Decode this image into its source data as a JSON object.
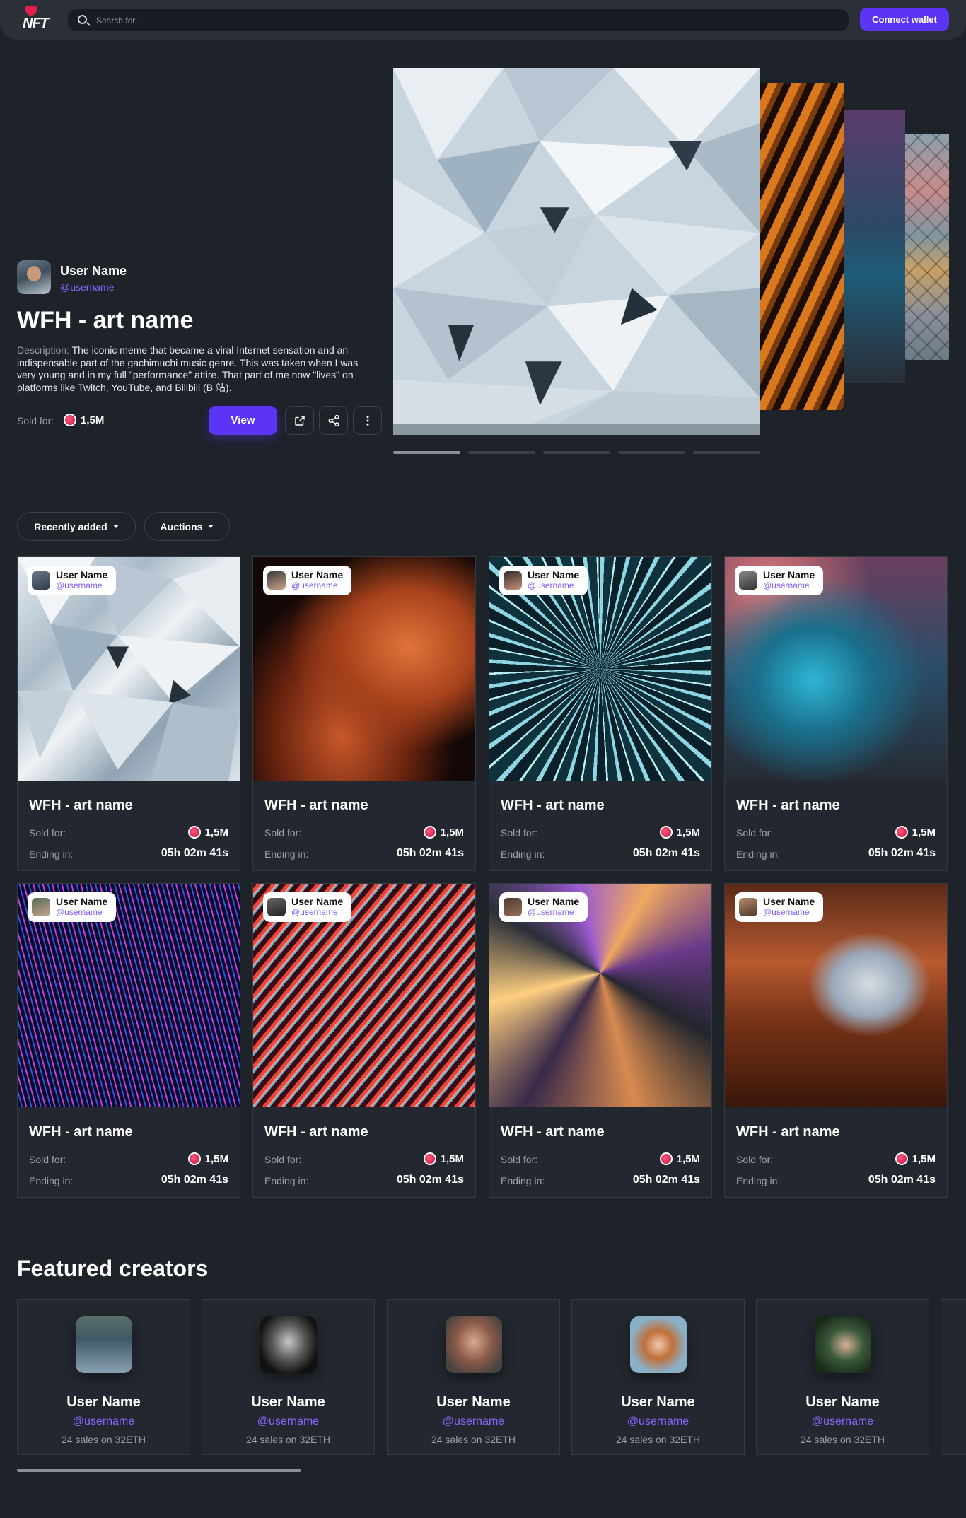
{
  "header": {
    "logo_text": "NFT",
    "search_placeholder": "Search for ...",
    "connect_label": "Connect wallet"
  },
  "hero": {
    "user_name": "User Name",
    "user_handle": "@username",
    "title": "WFH - art name",
    "description_label": "Description:",
    "description": "The iconic meme that became a viral Internet sensation and an indispensable part of the gachimuchi music genre. This was taken when I was very young and in my full \"performance\" attire. That part of me now \"lives\" on platforms like Twitch, YouTube, and Bilibili (B 站).",
    "sold_label": "Sold for:",
    "sold_value": "1,5M",
    "view_label": "View",
    "slides_count": 5,
    "active_slide": 1
  },
  "filters": {
    "recent_label": "Recently added",
    "auctions_label": "Auctions"
  },
  "cards": [
    {
      "user": "User Name",
      "handle": "@username",
      "title": "WFH - art name",
      "sold_label": "Sold for:",
      "sold": "1,5M",
      "end_label": "Ending in:",
      "end": "05h 02m 41s"
    },
    {
      "user": "User Name",
      "handle": "@username",
      "title": "WFH - art name",
      "sold_label": "Sold for:",
      "sold": "1,5M",
      "end_label": "Ending in:",
      "end": "05h 02m 41s"
    },
    {
      "user": "User Name",
      "handle": "@username",
      "title": "WFH - art name",
      "sold_label": "Sold for:",
      "sold": "1,5M",
      "end_label": "Ending in:",
      "end": "05h 02m 41s"
    },
    {
      "user": "User Name",
      "handle": "@username",
      "title": "WFH - art name",
      "sold_label": "Sold for:",
      "sold": "1,5M",
      "end_label": "Ending in:",
      "end": "05h 02m 41s"
    },
    {
      "user": "User Name",
      "handle": "@username",
      "title": "WFH - art name",
      "sold_label": "Sold for:",
      "sold": "1,5M",
      "end_label": "Ending in:",
      "end": "05h 02m 41s"
    },
    {
      "user": "User Name",
      "handle": "@username",
      "title": "WFH - art name",
      "sold_label": "Sold for:",
      "sold": "1,5M",
      "end_label": "Ending in:",
      "end": "05h 02m 41s"
    },
    {
      "user": "User Name",
      "handle": "@username",
      "title": "WFH - art name",
      "sold_label": "Sold for:",
      "sold": "1,5M",
      "end_label": "Ending in:",
      "end": "05h 02m 41s"
    },
    {
      "user": "User Name",
      "handle": "@username",
      "title": "WFH - art name",
      "sold_label": "Sold for:",
      "sold": "1,5M",
      "end_label": "Ending in:",
      "end": "05h 02m 41s"
    }
  ],
  "featured": {
    "title": "Featured creators",
    "creators": [
      {
        "name": "User Name",
        "handle": "@username",
        "sales": "24 sales on 32ETH"
      },
      {
        "name": "User Name",
        "handle": "@username",
        "sales": "24 sales on 32ETH"
      },
      {
        "name": "User Name",
        "handle": "@username",
        "sales": "24 sales on 32ETH"
      },
      {
        "name": "User Name",
        "handle": "@username",
        "sales": "24 sales on 32ETH"
      },
      {
        "name": "User Name",
        "handle": "@username",
        "sales": "24 sales on 32ETH"
      }
    ]
  },
  "colors": {
    "background": "#1e2229",
    "accent": "#5b34f5",
    "handle": "#8a66ff",
    "coin": "#e0204a"
  }
}
